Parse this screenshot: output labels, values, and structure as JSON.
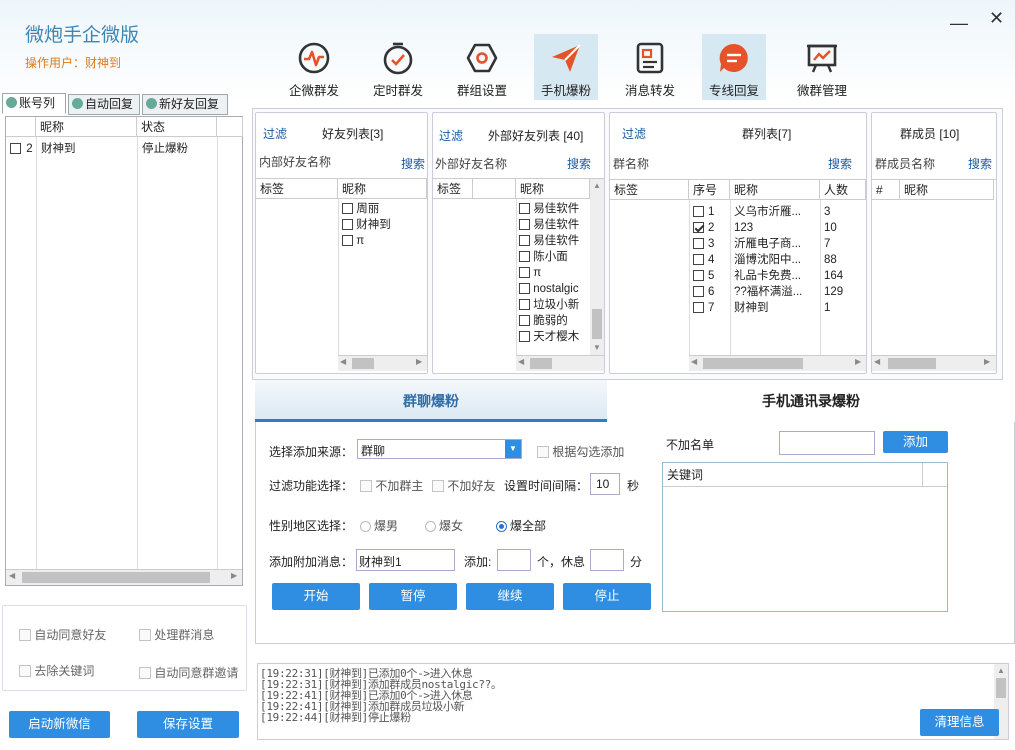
{
  "app": {
    "title": "微炮手企微版",
    "operator_label": "操作用户：",
    "operator_name": "财神到"
  },
  "toolbar": [
    {
      "label": "企微群发",
      "icon": "pulse-icon"
    },
    {
      "label": "定时群发",
      "icon": "clock-icon"
    },
    {
      "label": "群组设置",
      "icon": "hexagon-icon"
    },
    {
      "label": "手机爆粉",
      "icon": "send-icon",
      "active": true
    },
    {
      "label": "消息转发",
      "icon": "message-card-icon"
    },
    {
      "label": "专线回复",
      "icon": "chat-bubble-icon",
      "active": true
    },
    {
      "label": "微群管理",
      "icon": "presentation-chart-icon"
    }
  ],
  "left_tabs": [
    "账号列",
    "自动回复",
    "新好友回复"
  ],
  "account_table": {
    "headers": [
      "昵称",
      "状态"
    ],
    "rows": [
      {
        "index": "2",
        "name": "财神到",
        "status": "停止爆粉",
        "checked": false
      }
    ]
  },
  "options": {
    "auto_accept_friend": "自动同意好友",
    "handle_group_msg": "处理群消息",
    "remove_keyword": "去除关键词",
    "auto_accept_group_invite": "自动同意群邀请"
  },
  "bottom_buttons": {
    "launch": "启动新微信",
    "save": "保存设置",
    "clear": "清理信息"
  },
  "friend_panel": {
    "filter": "过滤",
    "title": "好友列表[3]",
    "subtitle": "内部好友名称",
    "search": "搜索",
    "col_tag": "标签",
    "col_name": "昵称",
    "items": [
      "周丽",
      "财神到",
      "π　　　　　　.."
    ]
  },
  "external_panel": {
    "filter": "过滤",
    "title": "外部好友列表 [40]",
    "subtitle": "外部好友名称",
    "search": "搜索",
    "col_tag": "标签",
    "col_name": "昵称",
    "items": [
      "易佳软件",
      "易佳软件",
      "易佳软件",
      "陈小面",
      "π",
      "nostalgic",
      "垃圾小新",
      "脆弱的",
      "天才樱木"
    ]
  },
  "group_panel": {
    "filter": "过滤",
    "title": "群列表[7]",
    "subtitle": "群名称",
    "search": "搜索",
    "col_tag": "标签",
    "col_index": "序号",
    "col_name": "昵称",
    "col_count": "人数",
    "rows": [
      {
        "index": "1",
        "name": "义乌市沂雁...",
        "count": "3",
        "checked": false
      },
      {
        "index": "2",
        "name": "123",
        "count": "10",
        "checked": true
      },
      {
        "index": "3",
        "name": "沂雁电子商...",
        "count": "7",
        "checked": false
      },
      {
        "index": "4",
        "name": "淄博沈阳中...",
        "count": "88",
        "checked": false
      },
      {
        "index": "5",
        "name": "礼品卡免费...",
        "count": "164",
        "checked": false
      },
      {
        "index": "6",
        "name": "??福杯满溢...",
        "count": "129",
        "checked": false
      },
      {
        "index": "7",
        "name": "财神到",
        "count": "1",
        "checked": false
      }
    ]
  },
  "member_panel": {
    "title": "群成员 [10]",
    "subtitle": "群成员名称",
    "search": "搜索",
    "col_hash": "#",
    "col_name": "昵称"
  },
  "mode_tabs": {
    "group": "群聊爆粉",
    "contacts": "手机通讯录爆粉"
  },
  "form": {
    "source_label": "选择添加来源：",
    "source_value": "群聊",
    "by_checked": "根据勾选添加",
    "filter_label": "过滤功能选择：",
    "no_owner": "不加群主",
    "no_friend": "不加好友",
    "interval_label": "设置时间间隔：",
    "interval_value": "10",
    "interval_unit": "秒",
    "gender_label": "性别地区选择：",
    "male": "爆男",
    "female": "爆女",
    "all": "爆全部",
    "extra_msg_label": "添加附加消息：",
    "extra_msg_value": "财神到1",
    "add_label": "添加:",
    "per_unit": "个，休息",
    "rest_unit": "分",
    "start": "开始",
    "pause": "暂停",
    "resume": "继续",
    "stop": "停止",
    "exclude_label": "不加名单",
    "exclude_add": "添加",
    "keyword_header": "关键词"
  },
  "log": [
    "[19:22:31][财神到]已添加0个->进入休息",
    "[19:22:31][财神到]添加群成员nostalgic??。",
    "[19:22:41][财神到]已添加0个->进入休息",
    "[19:22:41][财神到]添加群成员垃圾小新",
    "[19:22:44][财神到]停止爆粉"
  ]
}
